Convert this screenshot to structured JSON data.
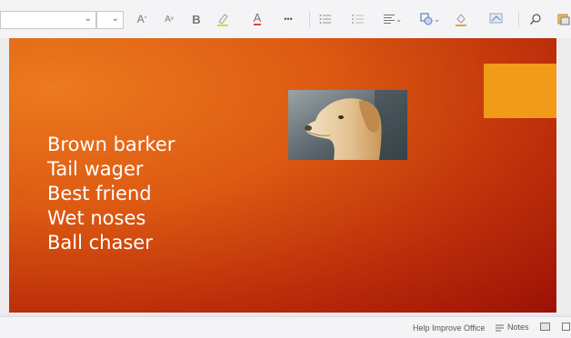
{
  "toolbar": {
    "icons": {
      "font_name": "font-name-dropdown",
      "font_size": "font-size-dropdown",
      "grow": "A",
      "shrink": "A",
      "bold": "B",
      "font_color": "A",
      "more": "•••",
      "chevron": "⌄"
    }
  },
  "slide": {
    "bullets": [
      "Brown barker",
      "Tail wager",
      "Best friend",
      "Wet noses",
      "Ball chaser"
    ],
    "colors": {
      "accent_block": "#f29a1a",
      "text": "#ffffff"
    }
  },
  "statusbar": {
    "help": "Help Improve Office",
    "notes": "Notes"
  }
}
